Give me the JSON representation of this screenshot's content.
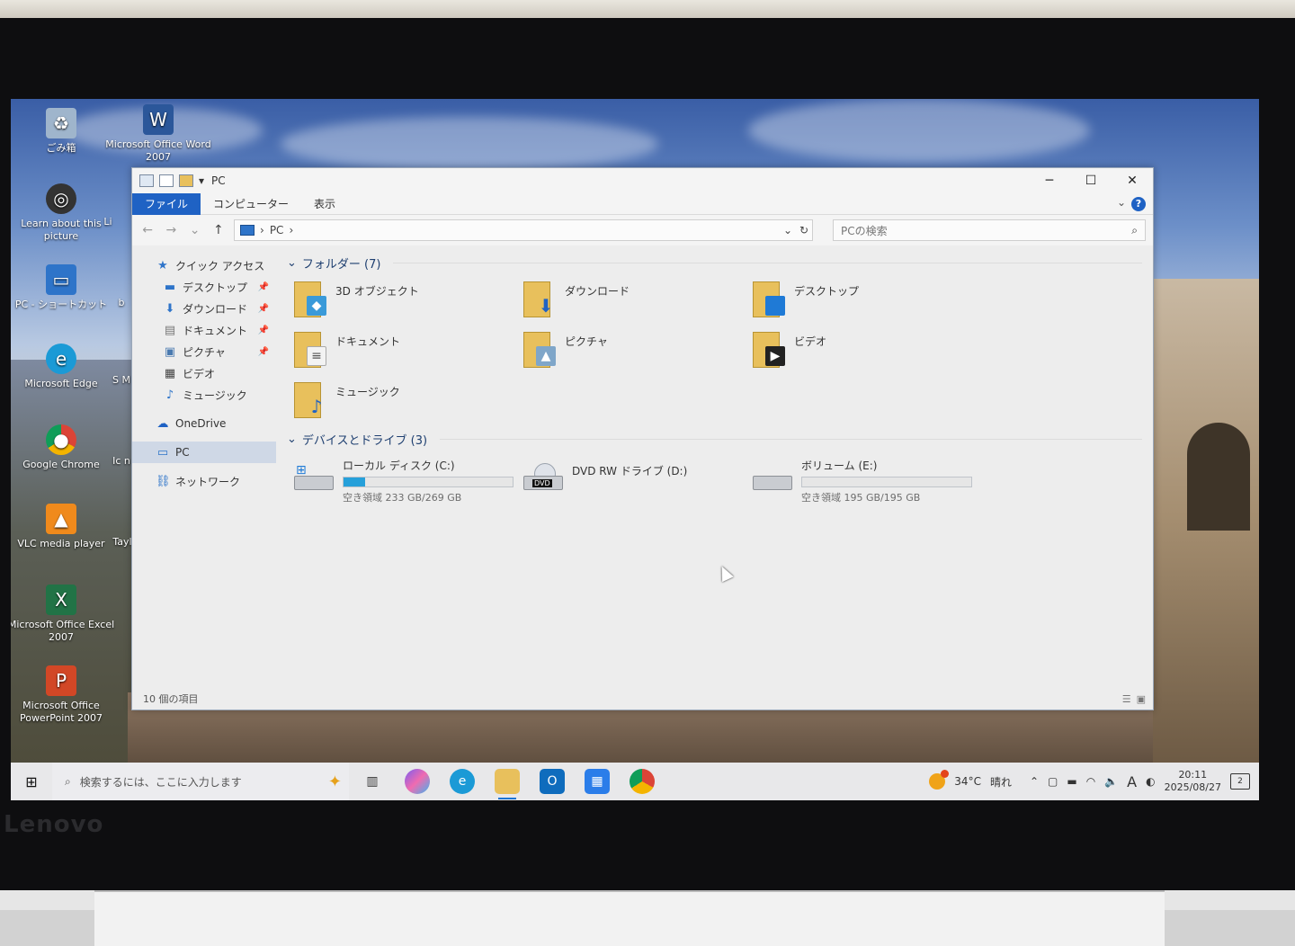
{
  "desktop": {
    "icons": [
      {
        "label": "ごみ箱",
        "icon": "recycle-bin-icon"
      },
      {
        "label": "Microsoft Office Word 2007",
        "icon": "word-icon"
      },
      {
        "label": "Learn about this picture",
        "icon": "camera-icon"
      },
      {
        "label": "PC - ショートカット",
        "icon": "pc-shortcut-icon"
      },
      {
        "label": "Microsoft Edge",
        "icon": "edge-icon"
      },
      {
        "label": "Google Chrome",
        "icon": "chrome-icon"
      },
      {
        "label": "VLC media player",
        "icon": "vlc-icon"
      },
      {
        "label": "Microsoft Office Excel 2007",
        "icon": "excel-icon"
      },
      {
        "label": "Microsoft Office PowerPoint 2007",
        "icon": "powerpoint-icon"
      }
    ],
    "partial_labels": [
      "Li",
      "b",
      "S M",
      "Ic n",
      "Tayl"
    ]
  },
  "explorer": {
    "title": "PC",
    "tabs": [
      "ファイル",
      "コンピューター",
      "表示"
    ],
    "address": "PC",
    "search_placeholder": "PCの検索",
    "nav": [
      {
        "label": "クイック アクセス",
        "icon": "star-icon",
        "pinned": false
      },
      {
        "label": "デスクトップ",
        "icon": "desktop-icon",
        "pinned": true
      },
      {
        "label": "ダウンロード",
        "icon": "download-icon",
        "pinned": true
      },
      {
        "label": "ドキュメント",
        "icon": "document-icon",
        "pinned": true
      },
      {
        "label": "ピクチャ",
        "icon": "picture-icon",
        "pinned": true
      },
      {
        "label": "ビデオ",
        "icon": "video-icon",
        "pinned": false
      },
      {
        "label": "ミュージック",
        "icon": "music-icon",
        "pinned": false
      },
      {
        "label": "OneDrive",
        "icon": "onedrive-icon",
        "pinned": false
      },
      {
        "label": "PC",
        "icon": "pc-icon",
        "pinned": false
      },
      {
        "label": "ネットワーク",
        "icon": "network-icon",
        "pinned": false
      }
    ],
    "folders_header": "フォルダー (7)",
    "folders": [
      {
        "label": "3D オブジェクト",
        "icon": "3d-objects-icon"
      },
      {
        "label": "ダウンロード",
        "icon": "download-icon"
      },
      {
        "label": "デスクトップ",
        "icon": "desktop-icon"
      },
      {
        "label": "ドキュメント",
        "icon": "document-icon"
      },
      {
        "label": "ピクチャ",
        "icon": "picture-icon"
      },
      {
        "label": "ビデオ",
        "icon": "video-icon"
      },
      {
        "label": "ミュージック",
        "icon": "music-icon"
      }
    ],
    "drives_header": "デバイスとドライブ (3)",
    "drives": [
      {
        "label": "ローカル ディスク (C:)",
        "sub": "空き領域 233 GB/269 GB",
        "used_fraction": 0.13,
        "icon": "local-disk-icon"
      },
      {
        "label": "DVD RW ドライブ (D:)",
        "sub": "",
        "icon": "dvd-drive-icon"
      },
      {
        "label": "ボリューム (E:)",
        "sub": "空き領域 195 GB/195 GB",
        "used_fraction": 0.0,
        "icon": "volume-icon"
      }
    ],
    "status": "10 個の項目"
  },
  "taskbar": {
    "search_placeholder": "検索するには、ここに入力します",
    "weather": "34°C",
    "weather_text": "晴れ",
    "time": "20:11",
    "date": "2025/08/27",
    "ime": "A",
    "notification_count": "2"
  },
  "brand": "Lenovo"
}
